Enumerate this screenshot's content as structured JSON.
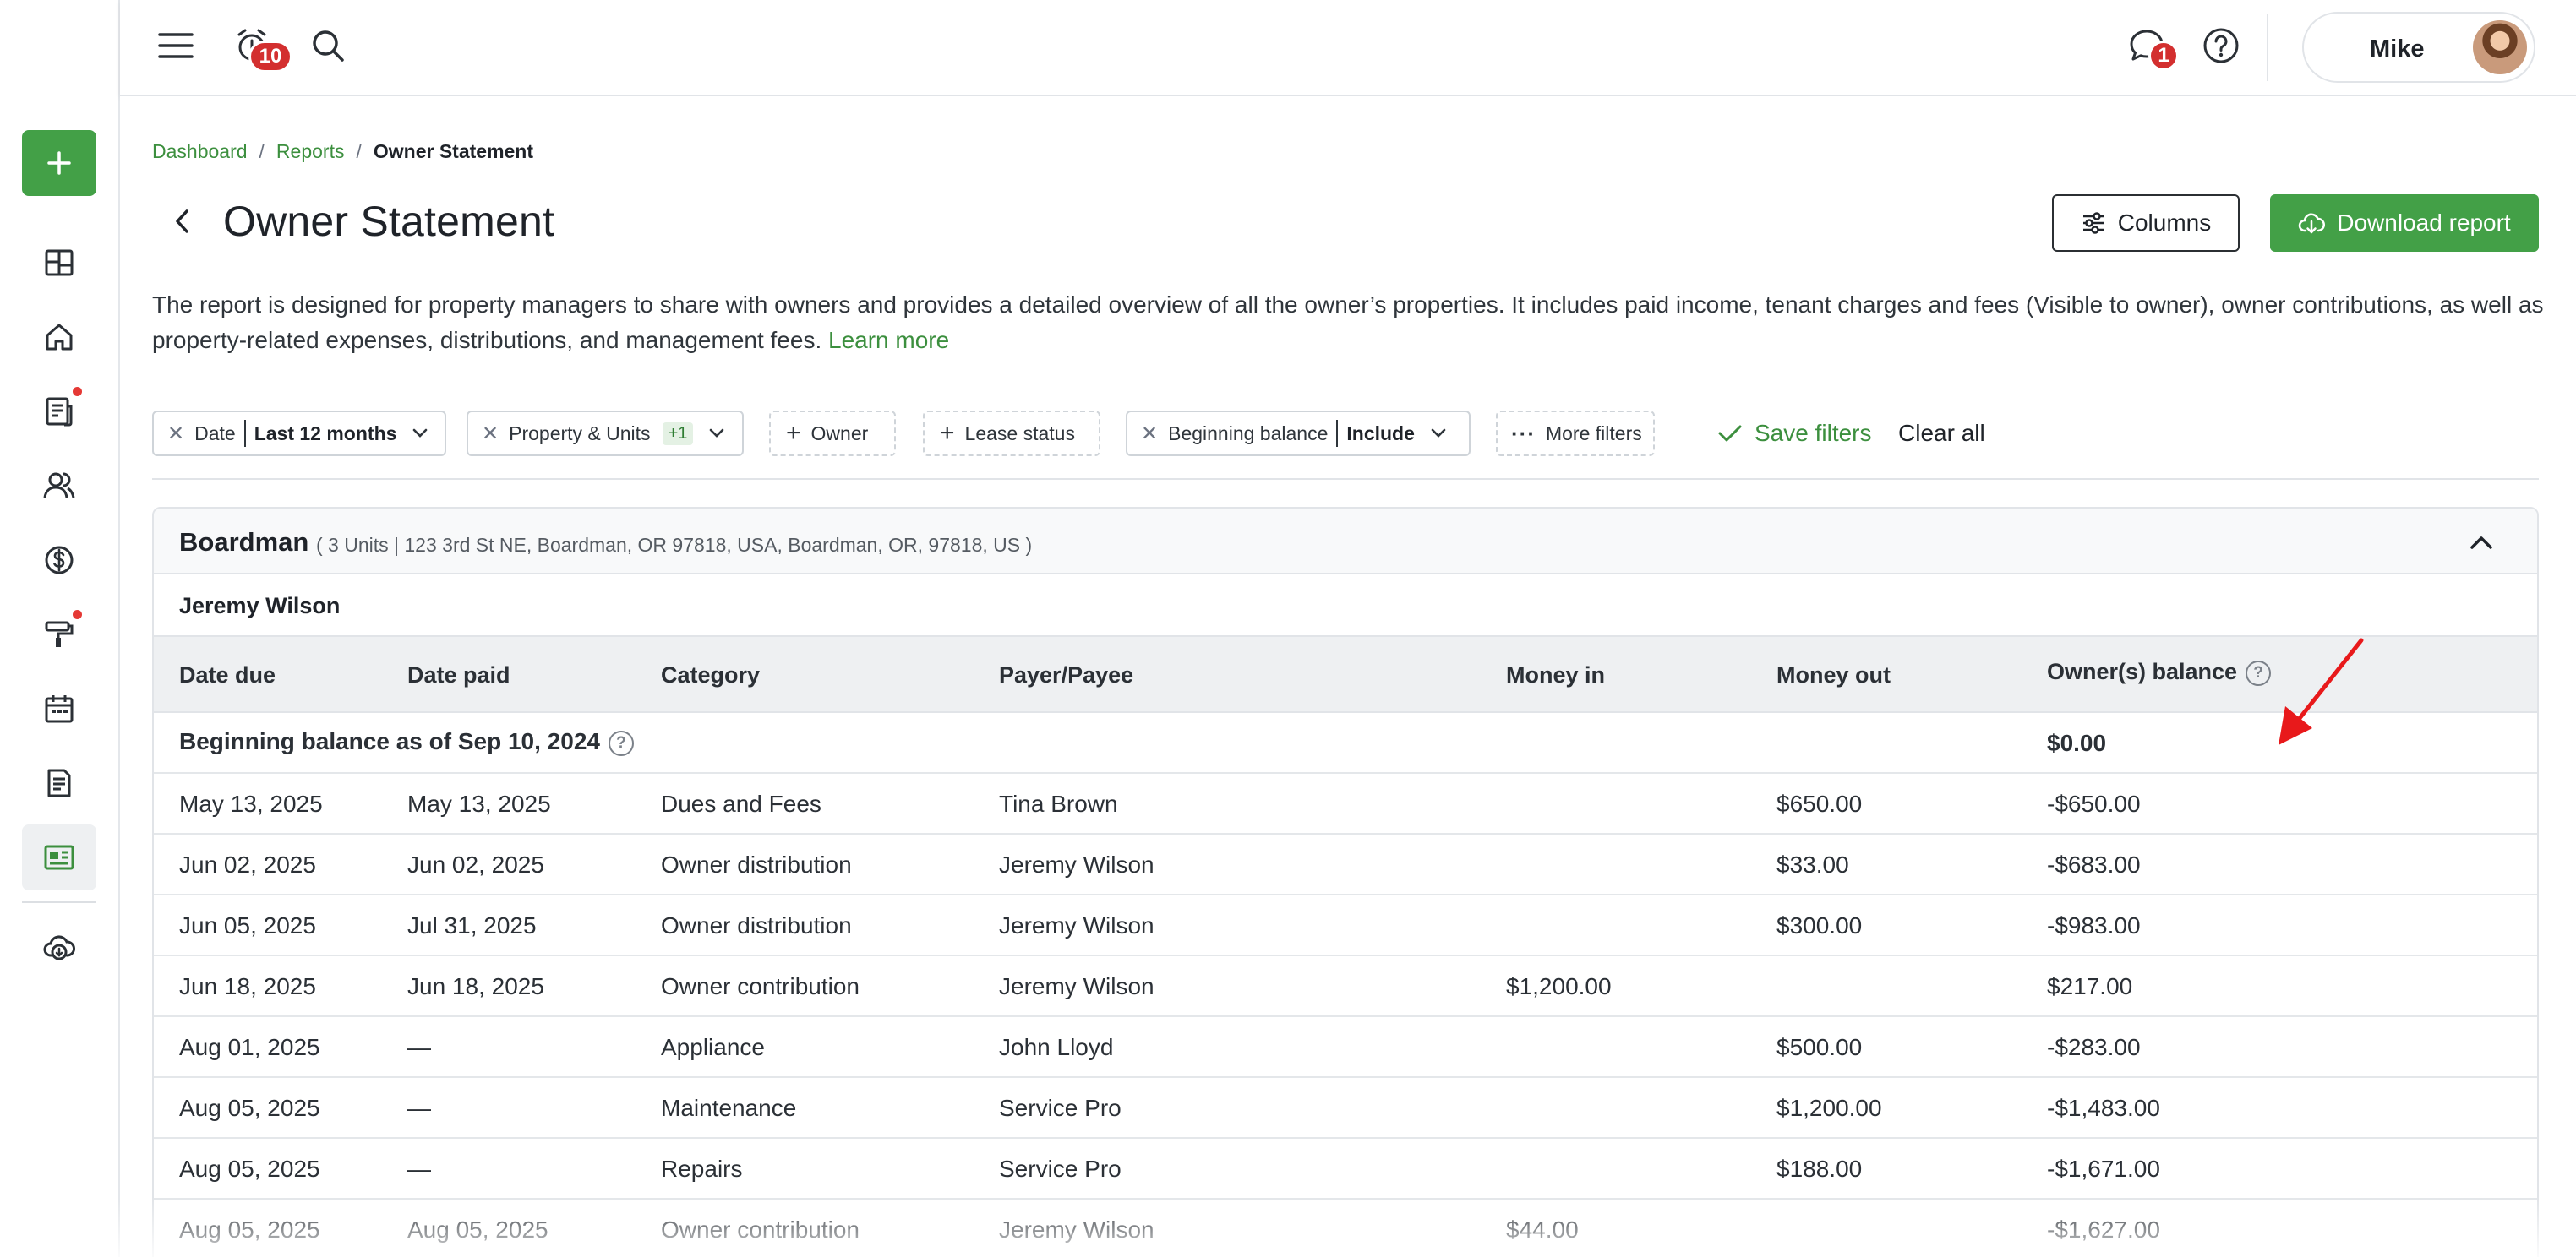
{
  "sidebar": {
    "add_button_icon": "plus-icon",
    "items": [
      {
        "icon": "dashboard-icon",
        "active": false,
        "dot": false
      },
      {
        "icon": "home-icon",
        "active": false,
        "dot": false
      },
      {
        "icon": "lease-icon",
        "active": false,
        "dot": true
      },
      {
        "icon": "people-icon",
        "active": false,
        "dot": false
      },
      {
        "icon": "dollar-icon",
        "active": false,
        "dot": false
      },
      {
        "icon": "paint-roller-icon",
        "active": false,
        "dot": true
      },
      {
        "icon": "calendar-icon",
        "active": false,
        "dot": false
      },
      {
        "icon": "document-icon",
        "active": false,
        "dot": false
      },
      {
        "icon": "reports-icon",
        "active": true,
        "dot": false
      },
      {
        "icon": "cloud-download-icon",
        "active": false,
        "dot": false
      }
    ]
  },
  "topbar": {
    "notifications_count": "10",
    "messages_count": "1",
    "user_name": "Mike"
  },
  "breadcrumb": {
    "items": [
      "Dashboard",
      "Reports"
    ],
    "current": "Owner Statement",
    "separator": "/"
  },
  "page": {
    "title": "Owner Statement",
    "columns_label": "Columns",
    "download_label": "Download report",
    "description": "The report is designed for property managers to share with owners and provides a detailed overview of all the owner’s properties. It includes paid income, tenant charges and fees (Visible to owner), owner contributions, as well as property-related expenses, distributions, and management fees.",
    "learn_more": "Learn more"
  },
  "filters": {
    "date_label": "Date",
    "date_value": "Last 12 months",
    "property_label": "Property & Units",
    "property_count": "+1",
    "owner_label": "Owner",
    "lease_status_label": "Lease status",
    "beginning_balance_label": "Beginning balance",
    "beginning_balance_value": "Include",
    "more_filters_label": "More filters",
    "save_filters_label": "Save filters",
    "clear_all_label": "Clear all"
  },
  "report": {
    "property_name": "Boardman",
    "property_address": "( 3 Units | 123 3rd St NE, Boardman, OR 97818, USA, Boardman, OR, 97818, US )",
    "owner_name": "Jeremy Wilson",
    "columns": {
      "date_due": "Date due",
      "date_paid": "Date paid",
      "category": "Category",
      "payer": "Payer/Payee",
      "money_in": "Money in",
      "money_out": "Money out",
      "balance": "Owner(s) balance"
    },
    "beginning_label": "Beginning balance as of Sep 10, 2024",
    "beginning_value": "$0.00",
    "rows": [
      {
        "date_due": "May 13, 2025",
        "date_paid": "May 13, 2025",
        "category": "Dues and Fees",
        "payer": "Tina Brown",
        "money_in": "",
        "money_out": "$650.00",
        "balance": "-$650.00"
      },
      {
        "date_due": "Jun 02, 2025",
        "date_paid": "Jun 02, 2025",
        "category": "Owner distribution",
        "payer": "Jeremy Wilson",
        "money_in": "",
        "money_out": "$33.00",
        "balance": "-$683.00"
      },
      {
        "date_due": "Jun 05, 2025",
        "date_paid": "Jul 31, 2025",
        "category": "Owner distribution",
        "payer": "Jeremy Wilson",
        "money_in": "",
        "money_out": "$300.00",
        "balance": "-$983.00"
      },
      {
        "date_due": "Jun 18, 2025",
        "date_paid": "Jun 18, 2025",
        "category": "Owner contribution",
        "payer": "Jeremy Wilson",
        "money_in": "$1,200.00",
        "money_out": "",
        "balance": "$217.00"
      },
      {
        "date_due": "Aug 01, 2025",
        "date_paid": "—",
        "category": "Appliance",
        "payer": "John Lloyd",
        "money_in": "",
        "money_out": "$500.00",
        "balance": "-$283.00"
      },
      {
        "date_due": "Aug 05, 2025",
        "date_paid": "—",
        "category": "Maintenance",
        "payer": "Service Pro",
        "money_in": "",
        "money_out": "$1,200.00",
        "balance": "-$1,483.00"
      },
      {
        "date_due": "Aug 05, 2025",
        "date_paid": "—",
        "category": "Repairs",
        "payer": "Service Pro",
        "money_in": "",
        "money_out": "$188.00",
        "balance": "-$1,671.00"
      },
      {
        "date_due": "Aug 05, 2025",
        "date_paid": "Aug 05, 2025",
        "category": "Owner contribution",
        "payer": "Jeremy Wilson",
        "money_in": "$44.00",
        "money_out": "",
        "balance": "-$1,627.00"
      }
    ]
  },
  "colors": {
    "accent_green": "#43a047",
    "link_green": "#3c8f3e",
    "badge_red": "#d32f2f",
    "annotation_red": "#e8191b"
  }
}
